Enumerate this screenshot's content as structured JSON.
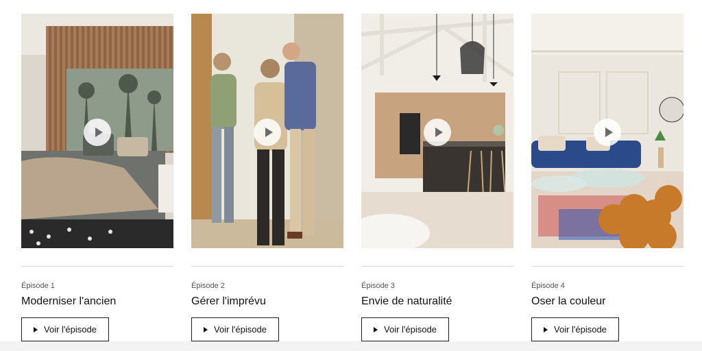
{
  "episodes": [
    {
      "label": "Épisode 1",
      "title": "Moderniser l'ancien",
      "cta": "Voir l'épisode"
    },
    {
      "label": "Épisode 2",
      "title": "Gérer l'imprévu",
      "cta": "Voir l'épisode"
    },
    {
      "label": "Épisode 3",
      "title": "Envie de naturalité",
      "cta": "Voir l'épisode"
    },
    {
      "label": "Épisode 4",
      "title": "Oser la couleur",
      "cta": "Voir l'épisode"
    }
  ],
  "icons": {
    "play": "play-icon",
    "button": "play-arrow-icon"
  }
}
